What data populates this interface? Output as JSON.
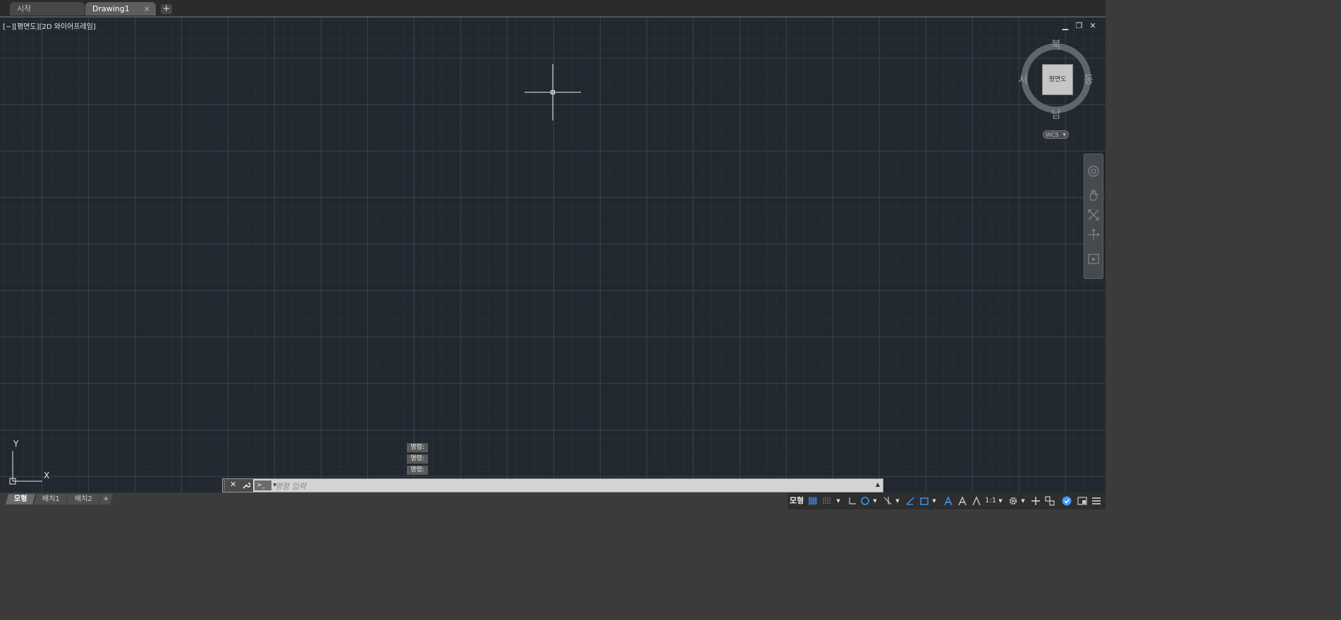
{
  "file_tabs": {
    "start_label": "시작",
    "drawing_label": "Drawing1",
    "close_glyph": "×",
    "add_glyph": "+"
  },
  "viewport": {
    "label": "[−][평면도][2D 와이어프레임]",
    "minimize_glyph": "▁",
    "restore_glyph": "❐",
    "close_glyph": "✕"
  },
  "viewcube": {
    "north": "북",
    "south": "남",
    "east": "동",
    "west": "서",
    "face": "평면도",
    "wcs": "WCS"
  },
  "navbar": {
    "icons": [
      "steering-wheel-icon",
      "pan-icon",
      "zoom-extents-icon",
      "orbit-icon",
      "showmotion-icon"
    ]
  },
  "ucs": {
    "x": "X",
    "y": "Y"
  },
  "command_history": [
    "명령:",
    "명령:",
    "명령:"
  ],
  "command_line": {
    "placeholder": "명령 입력",
    "prompt_glyph": ">_",
    "close_glyph": "✕",
    "wrench_glyph": "🔧",
    "expand_glyph": "▲"
  },
  "layout_tabs": {
    "model": "모형",
    "layout1": "배치1",
    "layout2": "배치2",
    "add": "+"
  },
  "status_bar": {
    "model_label": "모형",
    "scale": "1:1",
    "accent_color": "#3d9bff"
  },
  "colors": {
    "canvas_background": "#212830",
    "grid_major": "#5d6976",
    "command_line_background": "#d3d3d3"
  }
}
